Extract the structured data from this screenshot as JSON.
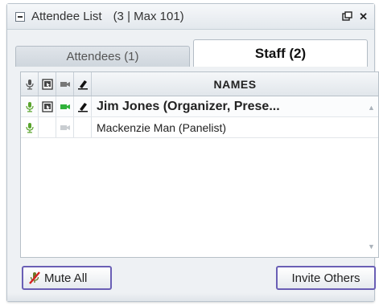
{
  "window": {
    "title": "Attendee List",
    "title_count": "(3 | Max 101)"
  },
  "tabs": [
    {
      "label": "Attendees (1)",
      "active": false
    },
    {
      "label": "Staff (2)",
      "active": true
    }
  ],
  "table": {
    "header_name": "NAMES",
    "rows": [
      {
        "name": "Jim Jones (Organizer, Prese...",
        "mic": true,
        "screen": true,
        "video": true,
        "annotate": true
      },
      {
        "name": "Mackenzie Man (Panelist)",
        "mic": true,
        "screen": false,
        "video": false,
        "annotate": false
      }
    ]
  },
  "buttons": {
    "mute_all": "Mute All",
    "invite_others": "Invite Others"
  },
  "colors": {
    "accent": "#6a5fb5",
    "mic_on": "#5aa42d",
    "video_on": "#2fb13a"
  }
}
